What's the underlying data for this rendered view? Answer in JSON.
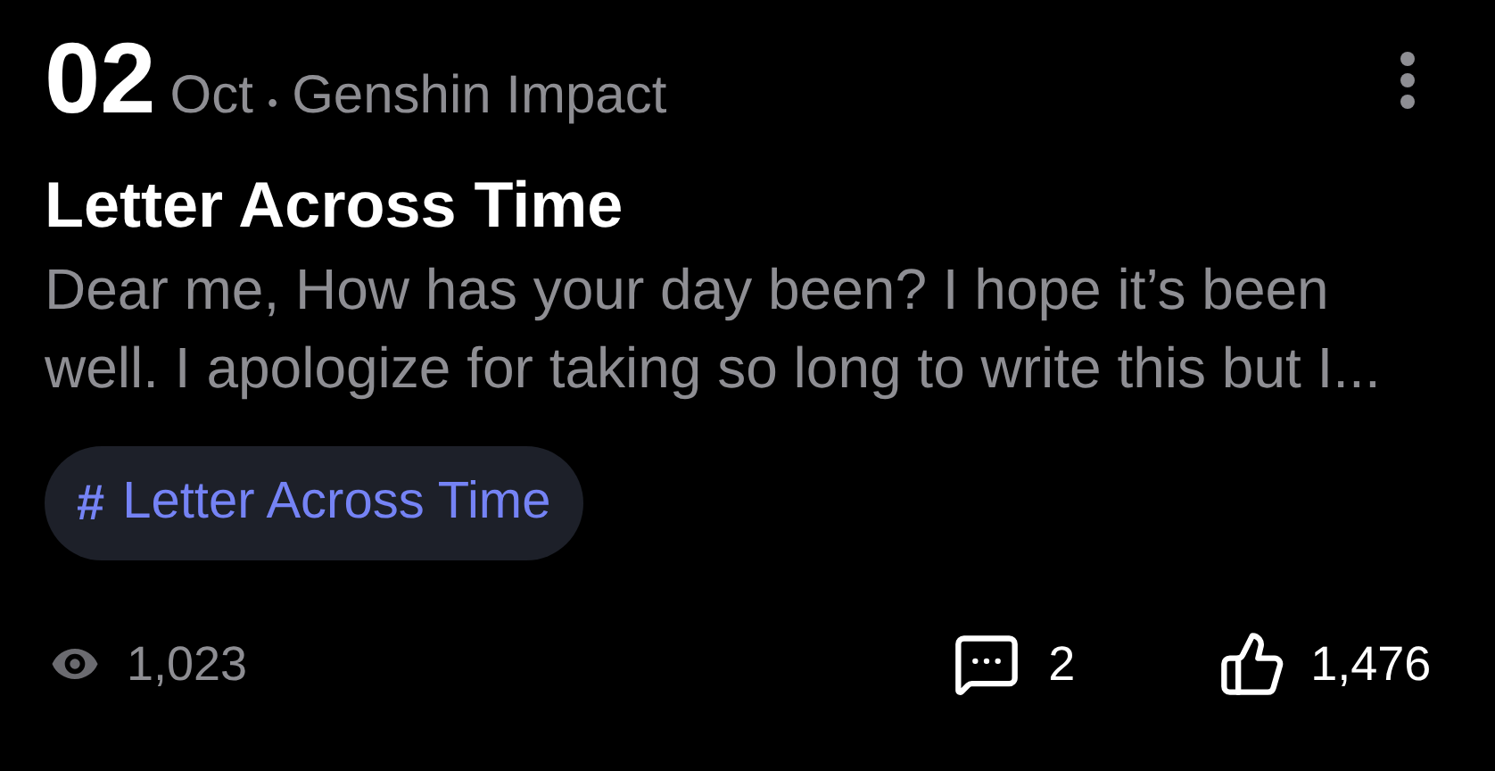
{
  "post": {
    "day": "02",
    "month": "Oct",
    "separator": "•",
    "game": "Genshin Impact",
    "title": "Letter Across Time",
    "excerpt": "Dear me, How has your day been? I hope it’s been well. I apologize for taking so long to write this but I...",
    "tags": [
      {
        "symbol": "#",
        "label": "Letter Across Time"
      }
    ]
  },
  "stats": {
    "views": "1,023",
    "comments": "2",
    "likes": "1,476"
  }
}
